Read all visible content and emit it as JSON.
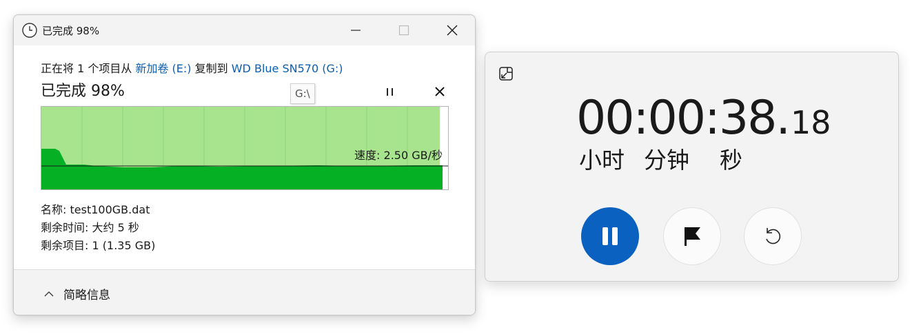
{
  "copy_dialog": {
    "title": "已完成 98%",
    "copy_line": {
      "prefix": "正在将 1 个项目从",
      "source": "新加卷 (E:)",
      "middle": "复制到",
      "destination": "WD Blue SN570 (G:)"
    },
    "progress_heading": "已完成 98%",
    "tooltip": "G:\\",
    "progress": {
      "percent": 98
    },
    "speed_label": "速度: 2.50 GB/秒",
    "details": {
      "name_label": "名称:",
      "name_value": "test100GB.dat",
      "time_label": "剩余时间:",
      "time_value": "大约 5 秒",
      "items_label": "剩余项目:",
      "items_value": "1 (1.35 GB)"
    },
    "less_details_label": "简略信息",
    "colors": {
      "graph_fill_light": "#a8e48e",
      "graph_fill_dark": "#06b025",
      "link": "#0a5fb4"
    }
  },
  "stopwatch": {
    "time_main": "00:00:38.",
    "time_fraction": "18",
    "units": {
      "hours": "小时",
      "minutes": "分钟",
      "seconds": "秒"
    },
    "colors": {
      "accent": "#0b61bf"
    }
  }
}
